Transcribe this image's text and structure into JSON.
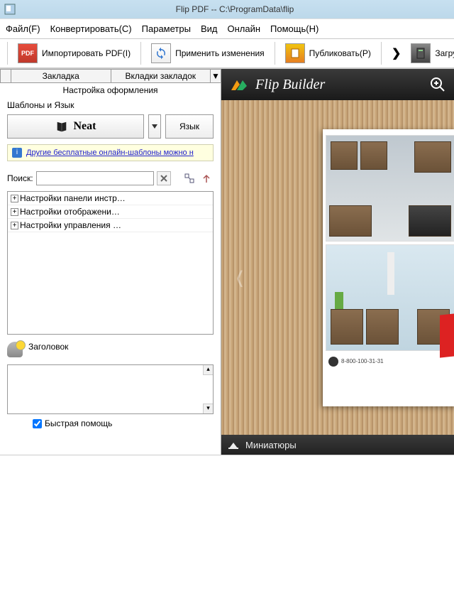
{
  "titlebar": {
    "title": "Flip PDF  --  C:\\ProgramData\\flip"
  },
  "menu": {
    "file": "Файл(F)",
    "convert": "Конвертировать(C)",
    "params": "Параметры",
    "view": "Вид",
    "online": "Онлайн",
    "help": "Помощь(H)"
  },
  "toolbar": {
    "import": "Импортировать PDF(I)",
    "apply": "Применить изменения",
    "publish": "Публиковать(P)",
    "upload": "Загрузить на онлайн с"
  },
  "tabs": {
    "bookmark": "Закладка",
    "bookmarks_tabs": "Вкладки закладок",
    "dd": "▼"
  },
  "panel": {
    "title": "Настройка оформления",
    "templates_lang": "Шаблоны и Язык",
    "neat": "Neat",
    "lang": "Язык",
    "link": "Другие бесплатные онлайн-шаблоны можно н",
    "search": "Поиск:",
    "tree": [
      "Настройки панели инстр…",
      "Настройки отображени…",
      "Настройки управления …"
    ],
    "header": "Заголовок",
    "quickhelp": "Быстрая помощь"
  },
  "preview": {
    "brand": "Flip Builder",
    "thumbs": "Миниатюры",
    "phone": "8-800-100-31-31"
  }
}
